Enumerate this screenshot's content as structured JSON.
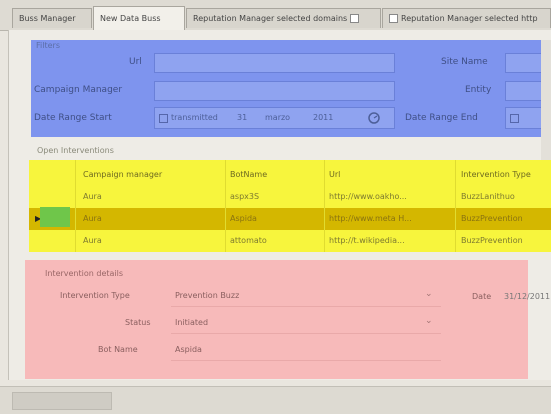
{
  "tabs": [
    {
      "label": "Buss Manager"
    },
    {
      "label": "New Data Buss"
    },
    {
      "label": "Reputation Manager selected domains"
    },
    {
      "label": "Reputation Manager selected http"
    }
  ],
  "filters": {
    "legend": "Filters",
    "url_label": "Url",
    "url_value": "",
    "campaign_label": "Campaign Manager",
    "campaign_value": "",
    "date_start_label": "Date Range Start",
    "date_start_parts": [
      "transmitted",
      "31",
      "marzo",
      "2011"
    ],
    "site_name_label": "Site Name",
    "site_name_value": "",
    "entity_label": "Entity",
    "entity_value": "",
    "date_end_label": "Date Range End"
  },
  "separator_legend": "Open Interventions",
  "table": {
    "columns": [
      "",
      "Campaign manager",
      "BotName",
      "Url",
      "Intervention Type"
    ],
    "rows": [
      [
        "",
        "Aura",
        "aspx3S",
        "http://www.oakho...",
        "BuzzLanithuo"
      ],
      [
        "",
        "Aura",
        "Aspida",
        "http://www.meta H...",
        "BuzzPrevention"
      ],
      [
        "",
        "Aura",
        "attomato",
        "http://t.wikipedia...",
        "BuzzPrevention"
      ]
    ],
    "selected_row": 1
  },
  "intervention": {
    "legend": "Intervention details",
    "type_label": "Intervention Type",
    "type_value": "Prevention Buzz",
    "status_label": "Status",
    "status_value": "Initiated",
    "bot_label": "Bot Name",
    "bot_value": "Aspida",
    "date_label": "Date",
    "date_value": "31/12/2011"
  },
  "colors": {
    "filters_region": "#7e94ee",
    "table_region": "#f7f53d",
    "selected_row": "#d4b700",
    "details_region": "#f7baba"
  }
}
